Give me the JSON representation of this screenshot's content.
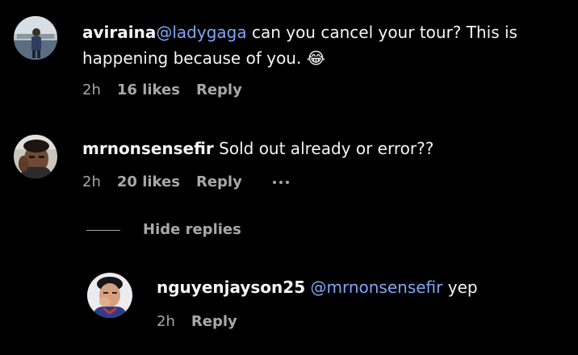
{
  "comments": [
    {
      "username": "aviraina",
      "mention": "@ladygaga",
      "text_line1": " can you cancel your tour? This is",
      "text_line2": "happening because of you. 😂",
      "time": "2h",
      "likes": "16 likes",
      "reply": "Reply"
    },
    {
      "username": "mrnonsensefir",
      "text": " Sold out already or error??",
      "time": "2h",
      "likes": "20 likes",
      "reply": "Reply",
      "more_icon": "more-horizontal-icon"
    }
  ],
  "hide_replies_label": "Hide replies",
  "replies": [
    {
      "username": "nguyenjayson25",
      "mention": "@mrnonsensefir",
      "text": " yep",
      "time": "2h",
      "reply": "Reply"
    }
  ],
  "colors": {
    "background": "#000000",
    "text": "#f5f5f5",
    "secondary": "#a8a8a8",
    "mention": "#7fa7f5"
  }
}
